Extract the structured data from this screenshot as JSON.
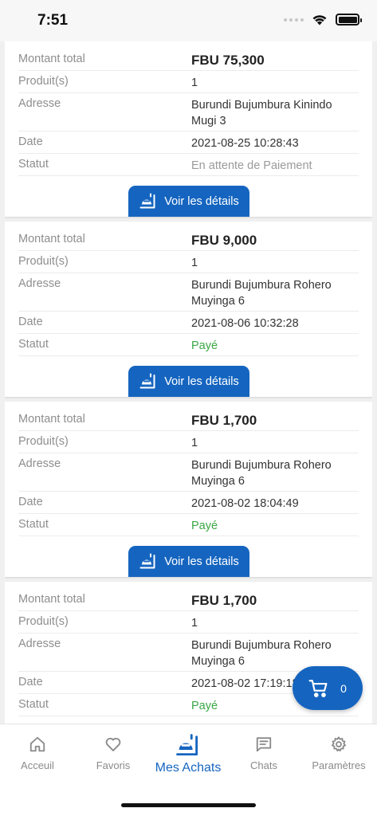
{
  "status_bar": {
    "time": "7:51"
  },
  "labels": {
    "amount": "Montant total",
    "products": "Produit(s)",
    "address": "Adresse",
    "date": "Date",
    "status": "Statut",
    "details_button": "Voir les détails"
  },
  "orders": [
    {
      "amount": "FBU 75,300",
      "products": "1",
      "address": "Burundi Bujumbura Kinindo Mugi 3",
      "date": "2021-08-25 10:28:43",
      "status": "En attente de Paiement"
    },
    {
      "amount": "FBU 9,000",
      "products": "1",
      "address": "Burundi Bujumbura Rohero Muyinga 6",
      "date": "2021-08-06 10:32:28",
      "status": "Payé"
    },
    {
      "amount": "FBU 1,700",
      "products": "1",
      "address": "Burundi Bujumbura Rohero Muyinga 6",
      "date": "2021-08-02 18:04:49",
      "status": "Payé"
    },
    {
      "amount": "FBU 1,700",
      "products": "1",
      "address": "Burundi Bujumbura Rohero Muyinga 6",
      "date": "2021-08-02 17:19:18",
      "status": "Payé"
    }
  ],
  "cart": {
    "count": "0"
  },
  "tabs": [
    {
      "label": "Acceuil",
      "icon": "home-icon"
    },
    {
      "label": "Favoris",
      "icon": "heart-icon"
    },
    {
      "label": "Mes Achats",
      "icon": "orders-icon"
    },
    {
      "label": "Chats",
      "icon": "chat-icon"
    },
    {
      "label": "Paramètres",
      "icon": "gear-icon"
    }
  ],
  "colors": {
    "accent": "#1565c0",
    "paid": "#3aa845",
    "pending": "#9a9a9a"
  }
}
